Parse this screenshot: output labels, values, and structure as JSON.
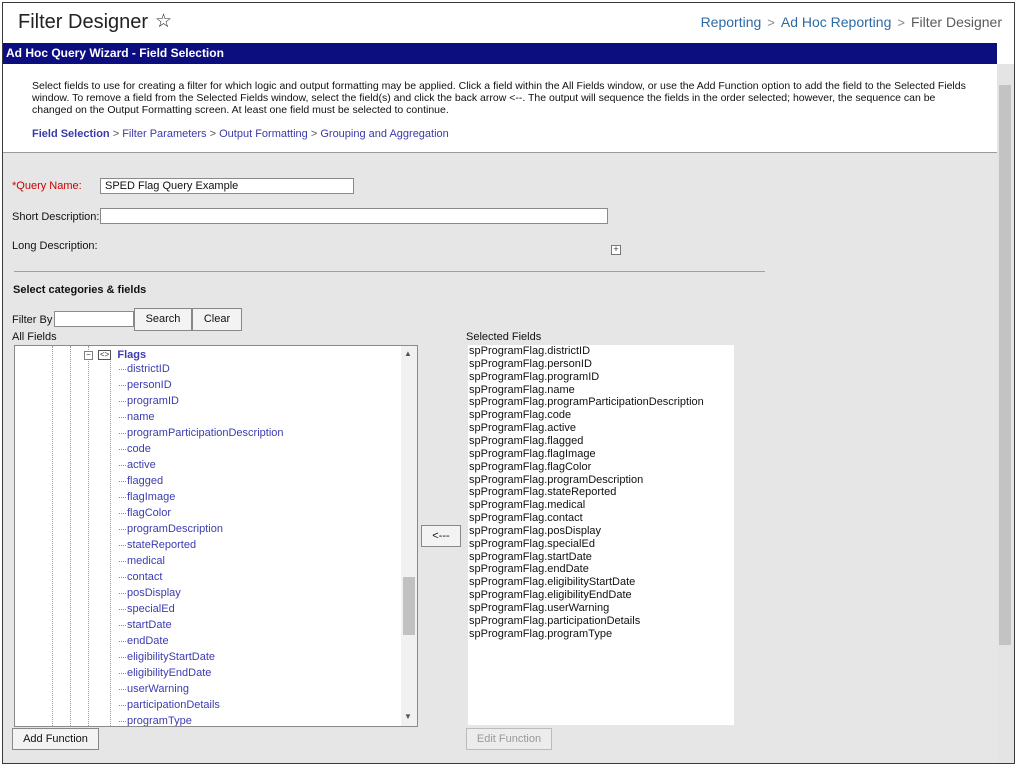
{
  "header": {
    "title": "Filter Designer",
    "breadcrumb": [
      "Reporting",
      "Ad Hoc Reporting",
      "Filter Designer"
    ]
  },
  "wizard": {
    "title": "Ad Hoc Query Wizard - Field Selection",
    "instructions": "Select fields to use for creating a filter for which logic and output formatting may be applied. Click a field within the All Fields window, or use the Add Function option to add the field to the Selected Fields window. To remove a field from the Selected Fields window, select the field(s) and click the back arrow <--. The output will sequence the fields in the order selected; however, the sequence can be changed on the Output Formatting screen. At least one field must be selected to continue.",
    "steps": [
      "Field Selection",
      "Filter Parameters",
      "Output Formatting",
      "Grouping and Aggregation"
    ],
    "step_separator": ">"
  },
  "form": {
    "query_name_label": "Query Name:",
    "query_name_required_mark": "*",
    "query_name_value": "SPED Flag Query Example",
    "short_description_label": "Short Description:",
    "short_description_value": "",
    "long_description_label": "Long Description:",
    "section_title": "Select categories & fields",
    "filter_by_label": "Filter By",
    "filter_by_value": "",
    "search_label": "Search",
    "clear_label": "Clear"
  },
  "all_fields": {
    "label": "All Fields",
    "category": "Flags",
    "items": [
      "districtID",
      "personID",
      "programID",
      "name",
      "programParticipationDescription",
      "code",
      "active",
      "flagged",
      "flagImage",
      "flagColor",
      "programDescription",
      "stateReported",
      "medical",
      "contact",
      "posDisplay",
      "specialEd",
      "startDate",
      "endDate",
      "eligibilityStartDate",
      "eligibilityEndDate",
      "userWarning",
      "participationDetails",
      "programType"
    ],
    "add_function_label": "Add Function"
  },
  "selected_fields": {
    "label": "Selected Fields",
    "items": [
      "spProgramFlag.districtID",
      "spProgramFlag.personID",
      "spProgramFlag.programID",
      "spProgramFlag.name",
      "spProgramFlag.programParticipationDescription",
      "spProgramFlag.code",
      "spProgramFlag.active",
      "spProgramFlag.flagged",
      "spProgramFlag.flagImage",
      "spProgramFlag.flagColor",
      "spProgramFlag.programDescription",
      "spProgramFlag.stateReported",
      "spProgramFlag.medical",
      "spProgramFlag.contact",
      "spProgramFlag.posDisplay",
      "spProgramFlag.specialEd",
      "spProgramFlag.startDate",
      "spProgramFlag.endDate",
      "spProgramFlag.eligibilityStartDate",
      "spProgramFlag.eligibilityEndDate",
      "spProgramFlag.userWarning",
      "spProgramFlag.participationDetails",
      "spProgramFlag.programType"
    ],
    "edit_function_label": "Edit Function"
  },
  "remove_arrow_label": "<---",
  "colors": {
    "wizard_bar": "#0c0e80",
    "link": "#2d6aa5",
    "tree_link": "#3c3cb0",
    "panel_bg": "#e6e6e6"
  }
}
